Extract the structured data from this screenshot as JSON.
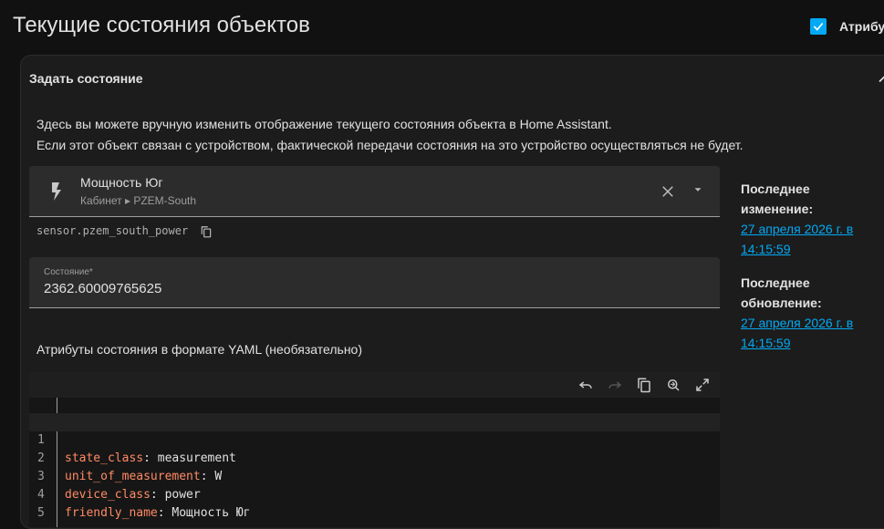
{
  "page": {
    "title": "Текущие состояния объектов",
    "attributes_toggle_label": "Атрибуты",
    "attributes_toggle_checked": true,
    "accent_color": "#03a9f4"
  },
  "card": {
    "title": "Задать состояние",
    "info_line1": "Здесь вы можете вручную изменить отображение текущего состояния объекта в Home Assistant.",
    "info_line2": "Если этот объект связан с устройством, фактической передачи состояния на это устройство осуществляться не будет."
  },
  "entity": {
    "icon": "flash-icon",
    "name": "Мощность Юг",
    "path": "Кабинет ▸ PZEM-South",
    "id": "sensor.pzem_south_power"
  },
  "state_field": {
    "label": "Состояние*",
    "value": "2362.60009765625"
  },
  "attributes": {
    "label": "Атрибуты состояния в формате YAML (необязательно)",
    "lines": [
      {
        "num": "1",
        "key": "state_class",
        "value": "measurement"
      },
      {
        "num": "2",
        "key": "unit_of_measurement",
        "value": "W"
      },
      {
        "num": "3",
        "key": "device_class",
        "value": "power"
      },
      {
        "num": "4",
        "key": "friendly_name",
        "value": "Мощность Юг"
      },
      {
        "num": "5",
        "key": "",
        "value": ""
      }
    ],
    "key_color": "#ff8a65"
  },
  "meta": {
    "last_changed_label": "Последнее изменение:",
    "last_changed_value": "27 апреля 2026 г. в 14:15:59",
    "last_updated_label": "Последнее обновление:",
    "last_updated_value": "27 апреля 2026 г. в 14:15:59"
  }
}
